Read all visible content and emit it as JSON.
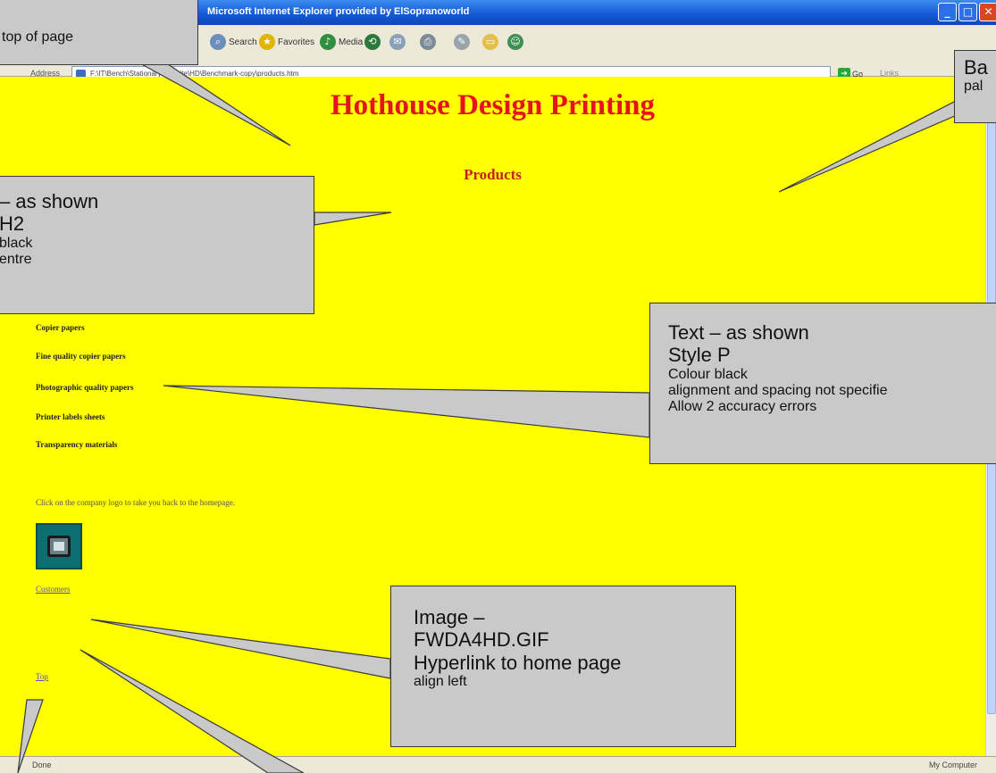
{
  "browser": {
    "title": "Microsoft Internet Explorer provided by ElSopranoworld",
    "toolbar": {
      "search": "Search",
      "favorites": "Favorites",
      "media": "Media"
    },
    "address_label": "Address",
    "address_value": "F:\\IT\\Bench\\Stationary\\website\\HD\\Benchmark-copy\\products.htm",
    "go": "Go",
    "links": "Links",
    "status_left": "Done",
    "status_right": "My Computer"
  },
  "page": {
    "background": "#ffff00",
    "heading1": "Hothouse Design Printing",
    "heading2": "Products",
    "products": [
      "Copier papers",
      "Fine quality copier papers",
      "Photographic quality papers",
      "Printer labels sheets",
      "Transparency materials"
    ],
    "back_text": "Click on the company logo to take you back to the homepage.",
    "link_customers": "Customers",
    "link_top": "Top"
  },
  "callouts": {
    "top_left": {
      "line1": "top of page"
    },
    "top_right": {
      "line1": "Ba",
      "line2": "pal"
    },
    "heading": {
      "line1": "– as shown",
      "line2": "H2",
      "line3": "black",
      "line4": "entre"
    },
    "text": {
      "line1": "Text – as shown",
      "line2": "Style P",
      "line3": "Colour black",
      "line4": "alignment and spacing not specifie",
      "line5": "Allow 2 accuracy errors"
    },
    "image": {
      "line1": "Image –",
      "line2": "FWDA4HD.GIF",
      "line3": "Hyperlink to home page",
      "line4": "align left"
    }
  }
}
